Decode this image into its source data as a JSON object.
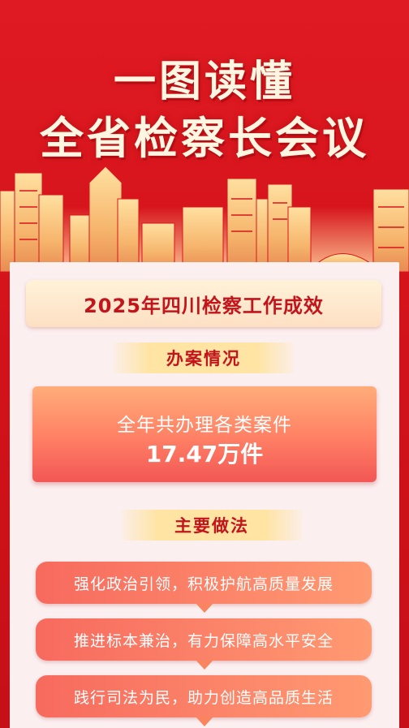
{
  "hero": {
    "title_line1": "一图读懂",
    "title_line2": "全省检察长会议"
  },
  "headline": "2025年四川检察工作成效",
  "case_section": {
    "tag": "办案情况",
    "line1": "全年共办理各类案件",
    "line2": "17.47万件"
  },
  "practice_section": {
    "tag": "主要做法",
    "items": [
      "强化政治引领，积极护航高质量发展",
      "推进标本兼治，有力保障高水平安全",
      "践行司法为民，助力创造高品质生活"
    ]
  },
  "colors": {
    "background_red": "#d9151d",
    "accent_red_text": "#c3141b",
    "gold_tag": "#ffe4a4",
    "panel_pink": "#fbeff0"
  }
}
